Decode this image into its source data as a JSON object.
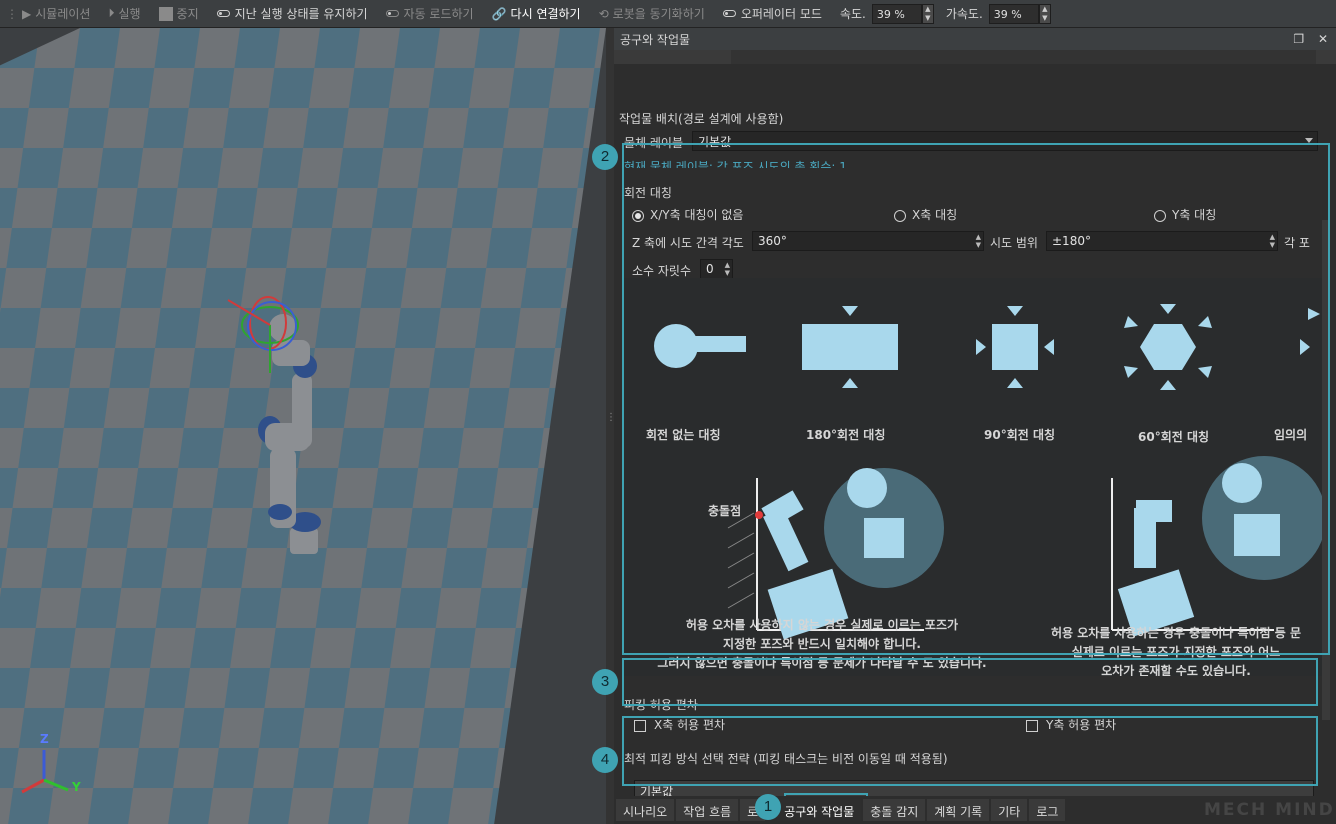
{
  "toolbar": {
    "simulation": "시뮬레이션",
    "run": "실행",
    "stop": "중지",
    "keep_state": "지난 실행 상태를 유지하기",
    "auto_load": "자동 로드하기",
    "reconnect": "다시 연결하기",
    "sync_robot": "로봇을 동기화하기",
    "operator_mode": "오퍼레이터 모드",
    "speed_label": "속도.",
    "speed_value": "39 %",
    "accel_label": "가속도.",
    "accel_value": "39 %",
    "reconnect_color": "#e23b3b"
  },
  "panel": {
    "title": "공구와 작업물",
    "placement_label": "작업물 배치(경로 설계에 사용함)",
    "object_label_title": "물체 레이블",
    "object_label_value": "기본값",
    "current_info": "현재 물체 레이블: 각 포즈 시도의 총 횟수: 1",
    "rotation": {
      "title": "회전 대칭",
      "radio_none": "X/Y축 대칭이 없음",
      "radio_x": "X축 대칭",
      "radio_y": "Y축 대칭",
      "selected": "X/Y축 대칭이 없음",
      "z_interval_label": "Z 축에 시도 간격 각도",
      "z_interval_value": "360°",
      "range_label": "시도 범위",
      "range_value": "±180°",
      "angle_cut": "각 포",
      "decimal_label": "소수 자릿수",
      "decimal_value": "0"
    },
    "illustration": {
      "sym_none": "회전 없는 대칭",
      "sym_180": "180°회전 대칭",
      "sym_90": "90°회전 대칭",
      "sym_60": "60°회전 대칭",
      "sym_any": "임의의",
      "collision_point": "충돌점",
      "left_text_1": "허용 오차를 사용하지 않는 경우 실제로 이르는 포즈가",
      "left_text_2": "지정한 포즈와 반드시 일치해야 합니다.",
      "left_text_3": "그러지 않으면 충돌이나 특이점 등 문제가 나타날 수 도 있습니다.",
      "right_text_1": "허용 오차를 사용하는 경우 충돌이나 특이점 등 문",
      "right_text_2": "실제로 이르는 포즈가 지정한 포즈와 어느",
      "right_text_3": "오차가 존재할 수도 있습니다."
    },
    "picking_tolerance": {
      "title": "피킹 허용 편차",
      "x_label": "X축 허용 편차",
      "y_label": "Y축 허용 편차"
    },
    "strategy": {
      "title": "최적 피킹 방식 선택 전략 (피킹 태스크는 비전 이동일 때 적용됨)",
      "value": "기본값"
    }
  },
  "bottom_tabs": [
    "시나리오",
    "작업 흐름",
    "로",
    "공구와 작업물",
    "충돌 감지",
    "계획 기록",
    "기타",
    "로그"
  ],
  "active_tab": "공구와 작업물",
  "callouts": [
    "1",
    "2",
    "3",
    "4"
  ],
  "axes": {
    "z": "Z",
    "y": "Y"
  },
  "watermark": "MECH MIND",
  "colors": {
    "accent": "#3fa3b3",
    "info_text": "#4aa8c0",
    "robot_body": "#8c8f93",
    "robot_joint": "#2f4f8a",
    "illus_fill": "#a9d8ec"
  }
}
